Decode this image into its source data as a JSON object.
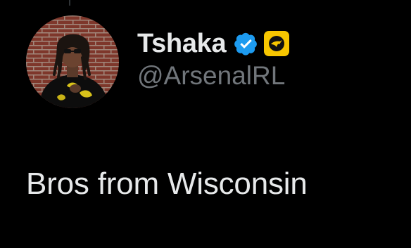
{
  "tweet": {
    "author": {
      "display_name": "Tshaka",
      "handle": "@ArsenalRL",
      "verified_badge_icon": "verified-checkmark-icon",
      "affiliate_badge_icon": "organization-affiliate-icon"
    },
    "text": "Bros from Wisconsin"
  },
  "colors": {
    "background": "#000000",
    "primary_text": "#e7e9ea",
    "secondary_text": "#71767b",
    "verified_blue": "#1d9bf0",
    "affiliate_yellow": "#f7c600"
  }
}
